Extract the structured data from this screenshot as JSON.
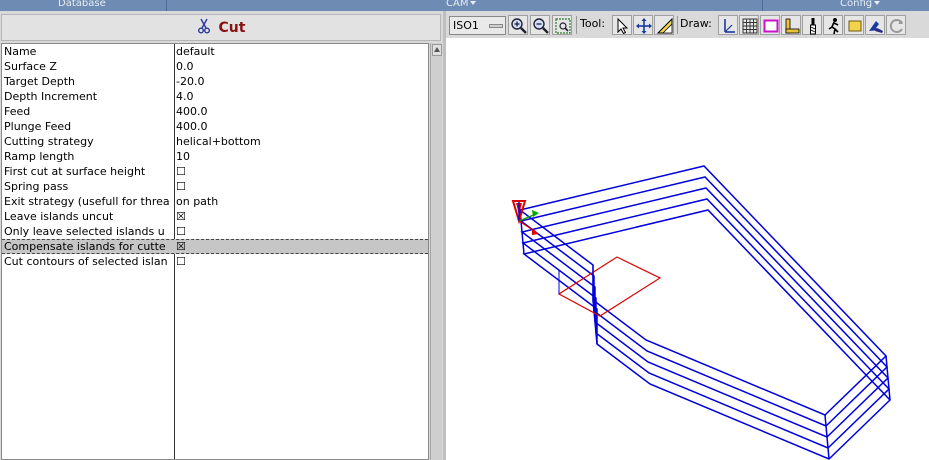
{
  "menubar": {
    "items": [
      {
        "label": "Database"
      },
      {
        "label": "CAM"
      },
      {
        "label": "Config"
      }
    ]
  },
  "panel": {
    "title": "Cut",
    "title_icon": "scissors-icon"
  },
  "properties": [
    {
      "name": "Name",
      "value": "default"
    },
    {
      "name": "Surface Z",
      "value": "0.0"
    },
    {
      "name": "Target Depth",
      "value": "-20.0"
    },
    {
      "name": "Depth Increment",
      "value": "4.0"
    },
    {
      "name": "Feed",
      "value": "400.0"
    },
    {
      "name": "Plunge Feed",
      "value": "400.0"
    },
    {
      "name": "Cutting strategy",
      "value": "helical+bottom"
    },
    {
      "name": "Ramp length",
      "value": "10"
    },
    {
      "name": "First cut at surface height",
      "value": "☐"
    },
    {
      "name": "Spring pass",
      "value": "☐"
    },
    {
      "name": "Exit strategy (usefull for threa",
      "value": "on path"
    },
    {
      "name": "Leave islands uncut",
      "value": "☒"
    },
    {
      "name": "Only leave selected islands u",
      "value": "☐"
    },
    {
      "name": "Compensate islands for cutte",
      "value": "☒"
    },
    {
      "name": "Cut contours of selected islan",
      "value": "☐"
    }
  ],
  "selected_row": 13,
  "toolbar": {
    "view_select": "ISO1",
    "tool_label": "Tool:",
    "draw_label": "Draw:",
    "icons": [
      "zoom-in-icon",
      "zoom-out-icon",
      "zoom-fit-icon",
      "select-arrow-icon",
      "move-icon",
      "ruler-icon",
      "axes-icon",
      "grid-icon",
      "margins-icon",
      "units-icon",
      "tool-profile-icon",
      "run-icon",
      "blank-icon",
      "camera-icon",
      "refresh-icon"
    ]
  },
  "colors": {
    "menubar": "#6e8bb3",
    "title": "#8b1010",
    "toolpath": "#0000dd",
    "island": "#dd0000"
  }
}
